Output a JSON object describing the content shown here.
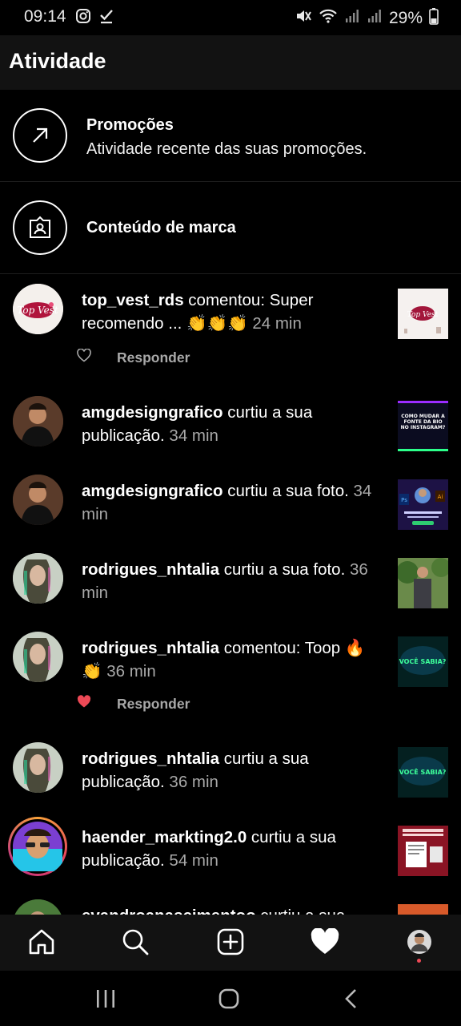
{
  "status_bar": {
    "time": "09:14",
    "battery": "29%",
    "icons": [
      "instagram-icon",
      "check-icon",
      "mute-icon",
      "wifi-icon",
      "signal-icon",
      "signal-icon",
      "battery-icon"
    ]
  },
  "header": {
    "title": "Atividade"
  },
  "promotions": {
    "title": "Promoções",
    "subtitle": "Atividade recente das suas promoções.",
    "icon": "arrow-up-right-icon"
  },
  "branded": {
    "title": "Conteúdo de marca",
    "icon": "brand-badge-icon"
  },
  "activities": [
    {
      "user": "top_vest_rds",
      "text": " comentou: Super recomendo ... 👏👏👏",
      "time": "24 min",
      "reply": "Responder",
      "liked": false
    },
    {
      "user": "amgdesigngrafico",
      "text": " curtiu a sua publicação.",
      "time": "34 min"
    },
    {
      "user": "amgdesigngrafico",
      "text": " curtiu a sua foto.",
      "time": "34 min"
    },
    {
      "user": "rodrigues_nhtalia",
      "text": " curtiu a sua foto.",
      "time": "36 min"
    },
    {
      "user": "rodrigues_nhtalia",
      "text": " comentou: Toop 🔥 👏",
      "time": "36 min",
      "reply": "Responder",
      "liked": true
    },
    {
      "user": "rodrigues_nhtalia",
      "text": " curtiu a sua publicação.",
      "time": "36 min"
    },
    {
      "user": "haender_markting2.0",
      "text": " curtiu a sua publicação.",
      "time": "54 min"
    },
    {
      "user": "evandroanascimentoo",
      "text": " curtiu a sua",
      "time": ""
    }
  ],
  "thumb_texts": {
    "t1": "Top Vest",
    "t2": "COMO MUDAR A FONTE DA BIO NO INSTAGRAM?",
    "t5": "VOCÊ SABIA?"
  },
  "colors": {
    "like_red": "#ed4956",
    "secondary": "#a8a8a8",
    "nav_bg": "#121212"
  },
  "bottom_nav": [
    "home-icon",
    "search-icon",
    "new-post-icon",
    "activity-heart-icon",
    "profile-avatar"
  ]
}
